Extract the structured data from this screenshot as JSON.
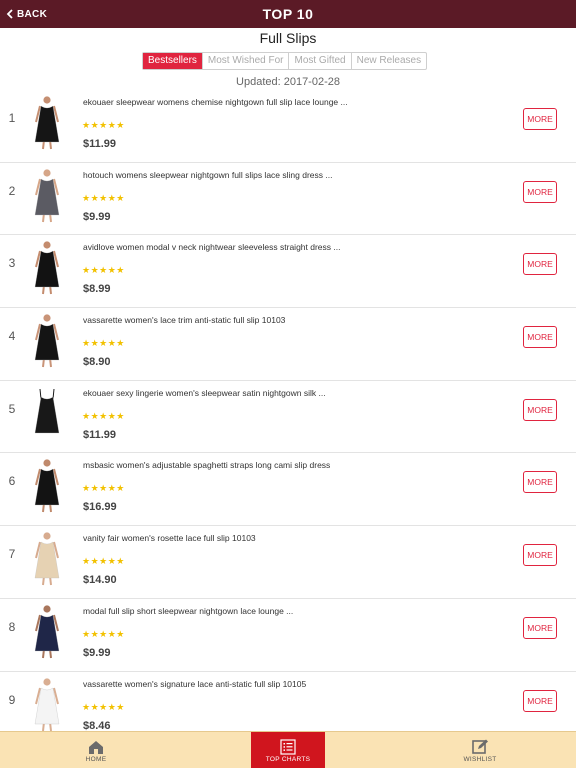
{
  "header": {
    "back_label": "BACK",
    "title": "TOP 10"
  },
  "category": {
    "title": "Full Slips"
  },
  "segments": [
    {
      "label": "Bestsellers",
      "active": true
    },
    {
      "label": "Most Wished For",
      "active": false
    },
    {
      "label": "Most Gifted",
      "active": false
    },
    {
      "label": "New Releases",
      "active": false
    }
  ],
  "updated": "Updated: 2017-02-28",
  "rating_stars": "★★★★★",
  "more_label": "MORE",
  "items": [
    {
      "rank": "1",
      "name": "ekouaer sleepwear womens chemise nightgown full slip lace lounge ...",
      "price": "$11.99",
      "color": "#151515",
      "skin": "#c58f72"
    },
    {
      "rank": "2",
      "name": "hotouch womens sleepwear nightgown full slips lace sling dress ...",
      "price": "$9.99",
      "color": "#5b5b63",
      "skin": "#d6a688"
    },
    {
      "rank": "3",
      "name": "avidlove women modal v neck nightwear sleeveless straight dress ...",
      "price": "$8.99",
      "color": "#121212",
      "skin": "#c48c6e"
    },
    {
      "rank": "4",
      "name": "vassarette women's lace trim anti-static full slip 10103",
      "price": "$8.90",
      "color": "#141414",
      "skin": "#c99478"
    },
    {
      "rank": "5",
      "name": "ekouaer sexy lingerie women's sleepwear satin nightgown silk ...",
      "price": "$11.99",
      "color": "#181818",
      "skin": ""
    },
    {
      "rank": "6",
      "name": "msbasic women's adjustable spaghetti straps long cami slip dress",
      "price": "$16.99",
      "color": "#131313",
      "skin": "#c08a6c"
    },
    {
      "rank": "7",
      "name": "vanity fair women's rosette lace full slip 10103",
      "price": "$14.90",
      "color": "#e6d2b3",
      "skin": "#d7ab8f"
    },
    {
      "rank": "8",
      "name": "modal full slip short sleepwear nightgown lace lounge ...",
      "price": "$9.99",
      "color": "#1f2648",
      "skin": "#a9765c"
    },
    {
      "rank": "9",
      "name": "vassarette women's signature lace anti-static full slip 10105",
      "price": "$8.46",
      "color": "#f4f4f4",
      "skin": "#d9ae92"
    }
  ],
  "tabs": [
    {
      "label": "HOME",
      "icon": "home-icon",
      "active": false
    },
    {
      "label": "TOP CHARTS",
      "icon": "chart-list-icon",
      "active": true
    },
    {
      "label": "WISHLIST",
      "icon": "edit-icon",
      "active": false
    }
  ],
  "colors": {
    "topbar": "#5b1a26",
    "accent": "#e0243f",
    "tabbar": "#fae3b4",
    "tab_active": "#d0151e",
    "stars": "#f2c100"
  }
}
